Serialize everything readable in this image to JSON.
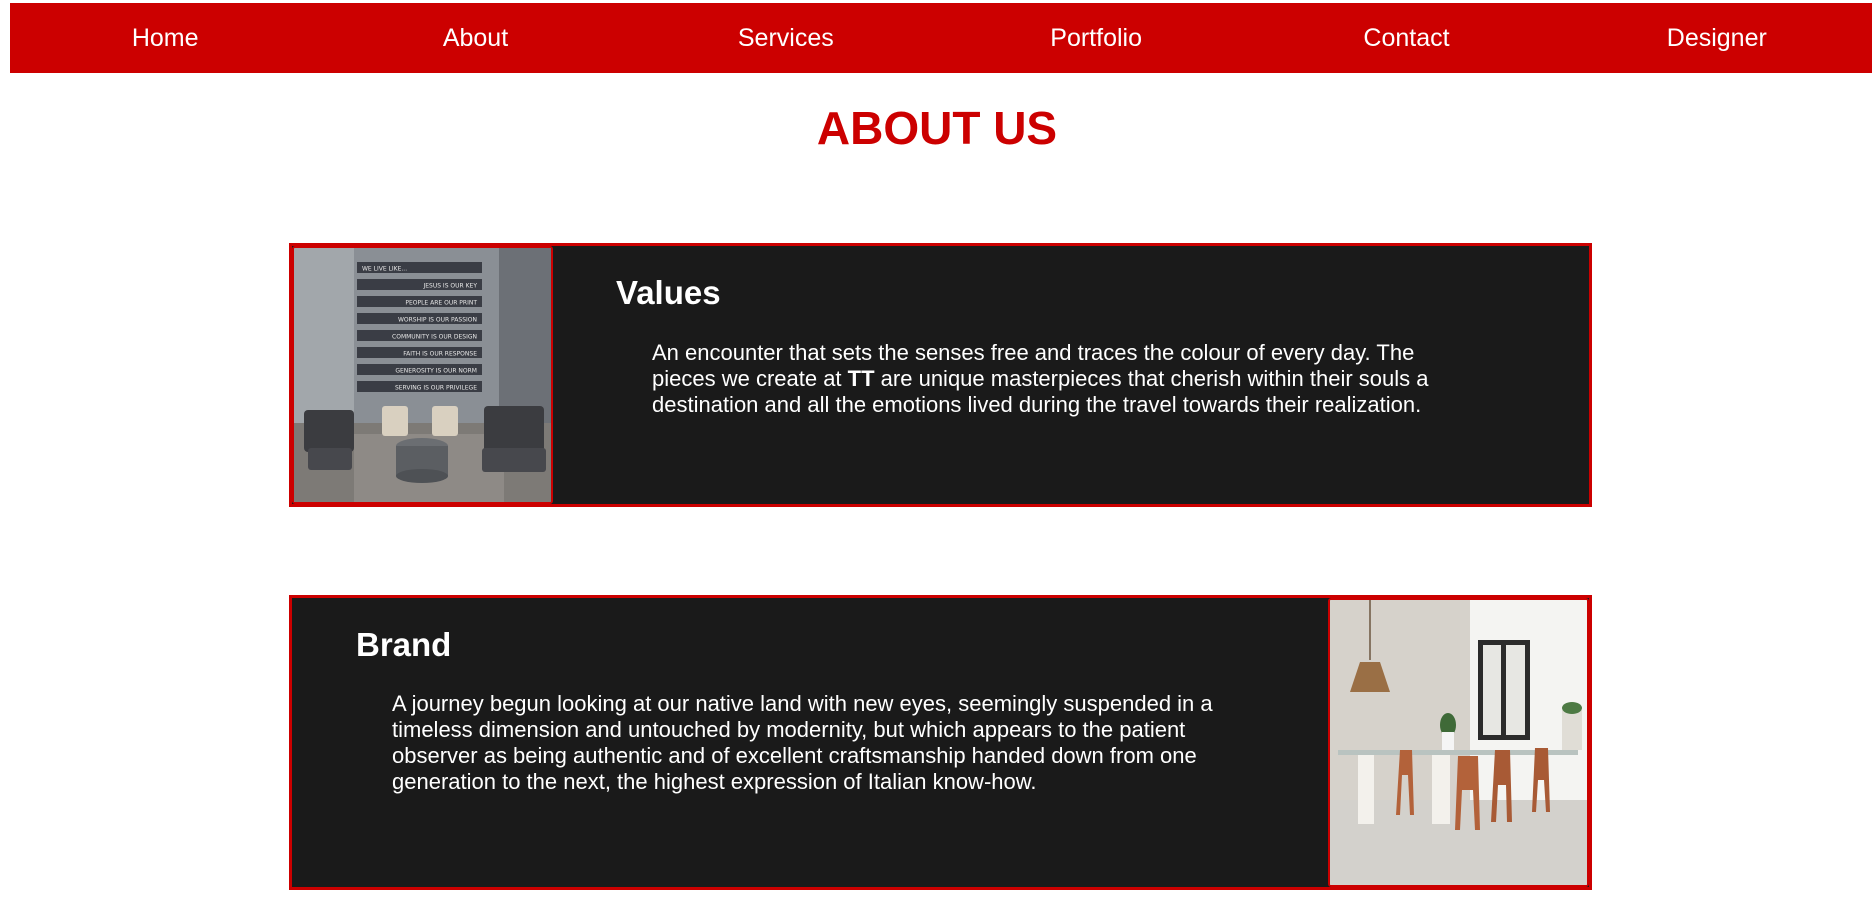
{
  "nav": {
    "items": [
      "Home",
      "About",
      "Services",
      "Portfolio",
      "Contact",
      "Designer"
    ]
  },
  "page": {
    "title": "ABOUT US"
  },
  "values": {
    "heading": "Values",
    "text_part1": "An encounter that sets the senses free and traces the colour of every day. The pieces we create at ",
    "text_bold": "TT",
    "text_part2": " are unique masterpieces that cherish within their souls a destination and all the emotions lived during the travel towards their realization.",
    "photo_wall_banner": [
      "WE LIVE LIKE...",
      "JESUS IS OUR KEY",
      "PEOPLE ARE OUR PRINT",
      "WORSHIP IS OUR PASSION",
      "COMMUNITY IS OUR DESIGN",
      "FAITH IS OUR RESPONSE",
      "GENEROSITY IS OUR NORM",
      "SERVING IS OUR PRIVILEGE"
    ]
  },
  "brand": {
    "heading": "Brand",
    "text": "A journey begun looking at our native land with new eyes, seemingly suspended in a timeless dimension and untouched by modernity, but which appears to the patient observer as being authentic and of excellent craftsmanship handed down from one generation to the next, the highest expression of Italian know-how."
  },
  "colors": {
    "accent": "#cc0000",
    "card_bg": "#1a1a1a",
    "text_light": "#ffffff"
  }
}
